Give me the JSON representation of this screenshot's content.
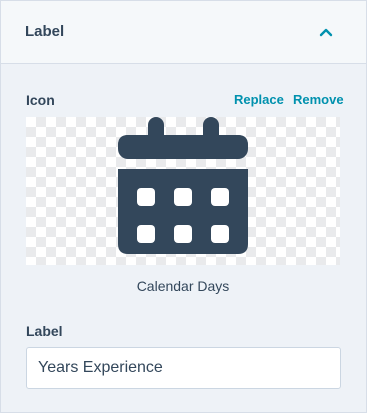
{
  "header": {
    "title": "Label"
  },
  "icon_section": {
    "label": "Icon",
    "replace_label": "Replace",
    "remove_label": "Remove",
    "icon_name": "Calendar Days",
    "icon_semantic": "calendar-days-icon"
  },
  "label_section": {
    "label": "Label",
    "value": "Years Experience"
  },
  "colors": {
    "text": "#33475b",
    "link": "#0091ae",
    "icon": "#33475b",
    "panel_bg": "#eef2f7",
    "header_bg": "#f5f8fa"
  }
}
